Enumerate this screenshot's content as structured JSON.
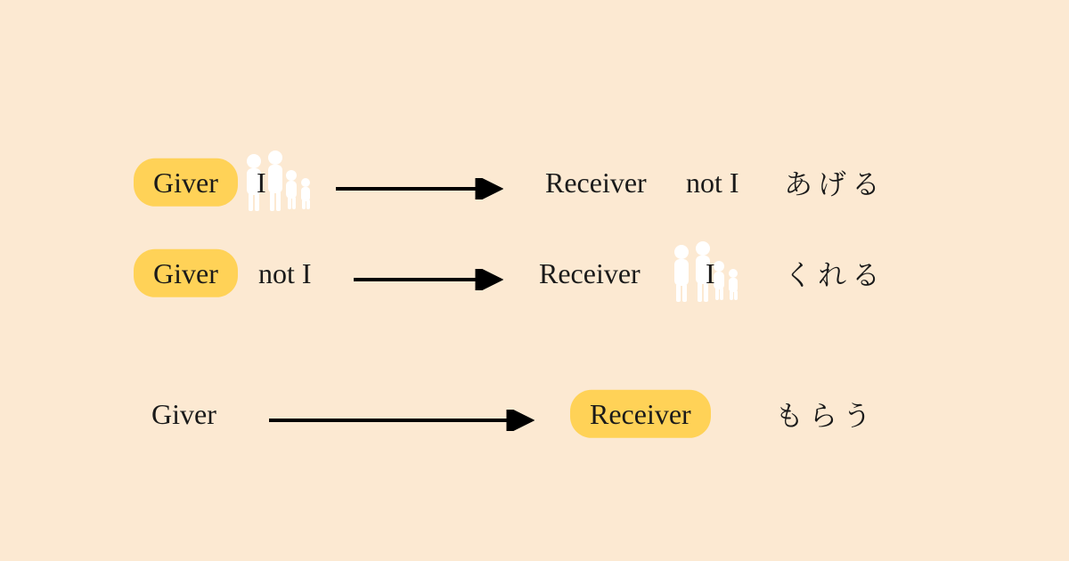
{
  "tokens": {
    "giver": "Giver",
    "receiver": "Receiver",
    "I": "I",
    "notI": "not I"
  },
  "verbs": {
    "ageru": "あげる",
    "kureru": "くれる",
    "morau": "もらう"
  },
  "colors": {
    "background": "#FCE9D2",
    "highlight": "#FFD257",
    "silhouette": "#FFFFFF",
    "text": "#000000"
  },
  "rows": [
    {
      "subject_role": "Giver",
      "subject_highlighted": true,
      "subject_person": "I",
      "subject_family_icon": true,
      "object_role": "Receiver",
      "object_highlighted": false,
      "object_person": "not I",
      "object_family_icon": false,
      "verb_jp": "あげる"
    },
    {
      "subject_role": "Giver",
      "subject_highlighted": true,
      "subject_person": "not I",
      "subject_family_icon": false,
      "object_role": "Receiver",
      "object_highlighted": false,
      "object_person": "I",
      "object_family_icon": true,
      "verb_jp": "くれる"
    },
    {
      "subject_role": "Giver",
      "subject_highlighted": false,
      "subject_person": null,
      "subject_family_icon": false,
      "object_role": "Receiver",
      "object_highlighted": true,
      "object_person": null,
      "object_family_icon": false,
      "verb_jp": "もらう"
    }
  ]
}
